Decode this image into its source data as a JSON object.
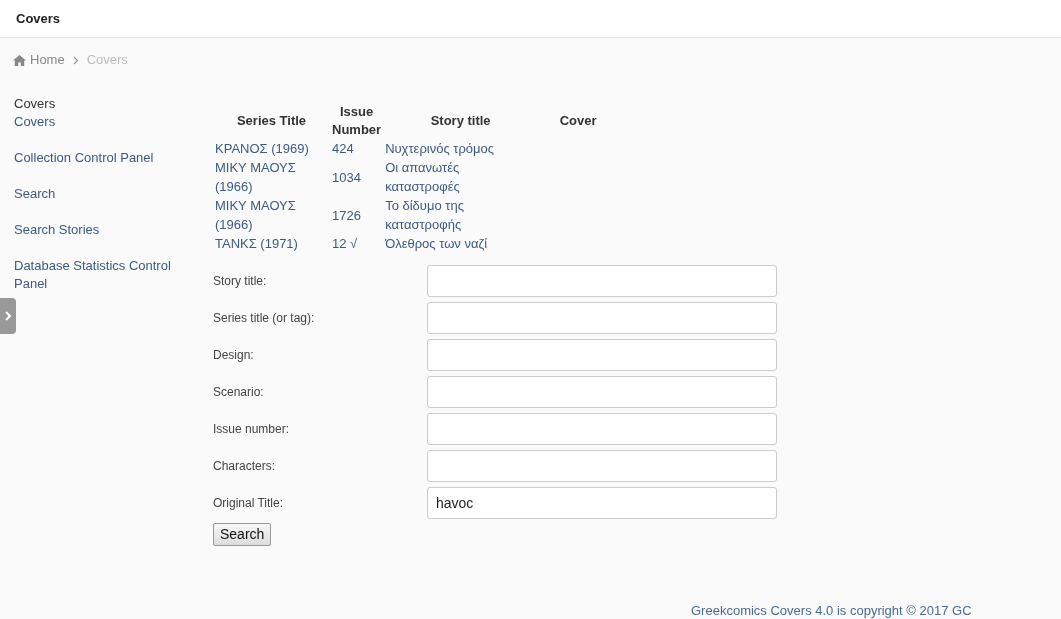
{
  "header": {
    "title": "Covers"
  },
  "breadcrumb": [
    {
      "label": "Home",
      "current": false
    },
    {
      "label": "Covers",
      "current": true
    }
  ],
  "sidebar": {
    "items": [
      {
        "kind": "heading",
        "label": "Covers"
      },
      {
        "kind": "link",
        "label": "Covers"
      },
      {
        "kind": "link",
        "label": "Collection Control Panel"
      },
      {
        "kind": "link",
        "label": "Search"
      },
      {
        "kind": "link",
        "label": "Search Stories"
      },
      {
        "kind": "link",
        "label": "Database Statistics Control Panel"
      }
    ]
  },
  "table": {
    "columns": [
      "Series Title",
      "Issue Number",
      "Story title",
      "Cover"
    ],
    "rows": [
      [
        "ΚΡΑΝΟΣ (1969)",
        "424",
        "Νυχτερινός τρόμος"
      ],
      [
        "ΜΙΚΥ ΜΑΟΥΣ (1966)",
        "1034",
        "Οι απανωτές καταστροφές"
      ],
      [
        "ΜΙΚΥ ΜΑΟΥΣ (1966)",
        "1726",
        "Το δίδυμο της καταστροφής"
      ],
      [
        "ΤΑΝΚΣ (1971)",
        "12 √",
        "Όλεθρος των ναζί"
      ]
    ]
  },
  "form": {
    "fields": [
      {
        "label": "Story title:"
      },
      {
        "label": "Series title (or tag):"
      },
      {
        "label": "Design:"
      },
      {
        "label": "Scenario:"
      },
      {
        "label": "Issue number:"
      },
      {
        "label": "Characters:"
      },
      {
        "label": "Original Title:",
        "value": "havoc"
      }
    ],
    "button": "Search"
  },
  "footer": "Greekcomics Covers 4.0 is copyright © 2017 GC"
}
